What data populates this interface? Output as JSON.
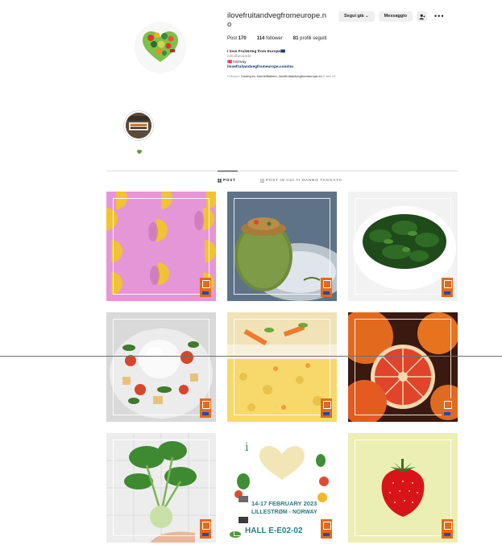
{
  "profile": {
    "username": "ilovefruitandvegfromeurope.no",
    "follow_label": "Segui già",
    "message_label": "Messaggio",
    "stats": {
      "posts_count": "170",
      "posts_label": "Post",
      "followers_count": "114",
      "followers_label": "follower",
      "following_count": "81",
      "following_label": "profili seguiti"
    },
    "bio": {
      "name": "I love Fruit&Veg from Europe🇪🇺",
      "category": "Cibo/bevande",
      "location": "🇳🇴 Norway",
      "link": "ilovefruitandvegfromeurope.com/no",
      "followers_prefix": "Follower:",
      "followers_names": "momvpvs, emmellitabers, ilovefruitandvegfromeurope.eu",
      "followers_suffix": "e altri 10"
    }
  },
  "tabs": {
    "posts": "POST",
    "tagged": "POST IN CUI TI HANNO TAGGATO"
  },
  "posts": {
    "p8": {
      "date": "14-17 FEBRUARY 2023",
      "place": "LILLESTRØM - NORWAY",
      "hall": "HALL E-E02-02"
    }
  },
  "colors": {
    "background": "#ffffff",
    "button_bg": "#efefef",
    "link": "#00376b",
    "badge_orange": "#e06a1e",
    "badge_blue": "#2a4aa0"
  },
  "icons": {
    "grid": "grid-icon",
    "tagged": "tag-icon",
    "more": "more-icon",
    "suggest": "person-add-icon",
    "chevron": "chevron-down-icon"
  }
}
